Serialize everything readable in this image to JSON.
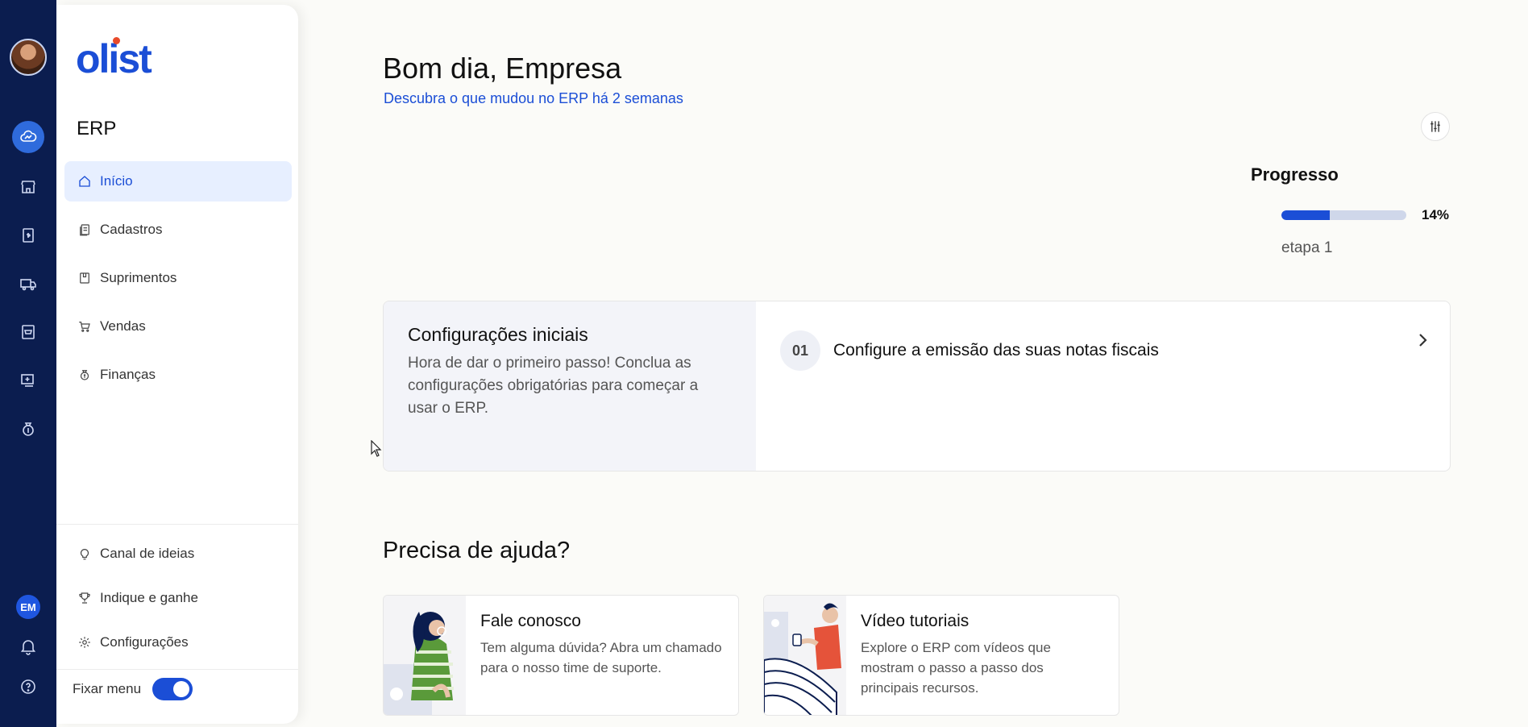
{
  "brand": {
    "logo": "olist",
    "module": "ERP"
  },
  "user": {
    "initials": "EM"
  },
  "sidebar": {
    "items": [
      {
        "label": "Início",
        "icon": "home-icon",
        "active": true
      },
      {
        "label": "Cadastros",
        "icon": "document-icon"
      },
      {
        "label": "Suprimentos",
        "icon": "box-icon"
      },
      {
        "label": "Vendas",
        "icon": "cart-icon"
      },
      {
        "label": "Finanças",
        "icon": "money-bag-icon"
      }
    ],
    "bottom_items": [
      {
        "label": "Canal de ideias",
        "icon": "lightbulb-icon"
      },
      {
        "label": "Indique e ganhe",
        "icon": "trophy-icon"
      },
      {
        "label": "Configurações",
        "icon": "gear-icon"
      }
    ],
    "pin_label": "Fixar menu",
    "pin_enabled": true
  },
  "header": {
    "greeting": "Bom dia, Empresa",
    "news_link": "Descubra o que mudou no ERP há 2 semanas"
  },
  "progress": {
    "title": "Progresso",
    "value": 14,
    "percent_label": "14%",
    "step_label": "etapa 1"
  },
  "setup": {
    "title": "Configurações iniciais",
    "description": "Hora de dar o primeiro passo! Conclua as configurações obrigatórias para começar a usar o ERP.",
    "step_number": "01",
    "step_text": "Configure a emissão das suas notas fiscais"
  },
  "help": {
    "title": "Precisa de ajuda?",
    "cards": [
      {
        "title": "Fale conosco",
        "text": "Tem alguma dúvida? Abra um chamado para o nosso time de suporte."
      },
      {
        "title": "Vídeo tutoriais",
        "text": "Explore o ERP com vídeos que mostram o passo a passo dos principais recursos."
      }
    ]
  },
  "colors": {
    "rail": "#0b1d4f",
    "accent": "#1b4ed6",
    "active_bg": "#e7efff"
  }
}
